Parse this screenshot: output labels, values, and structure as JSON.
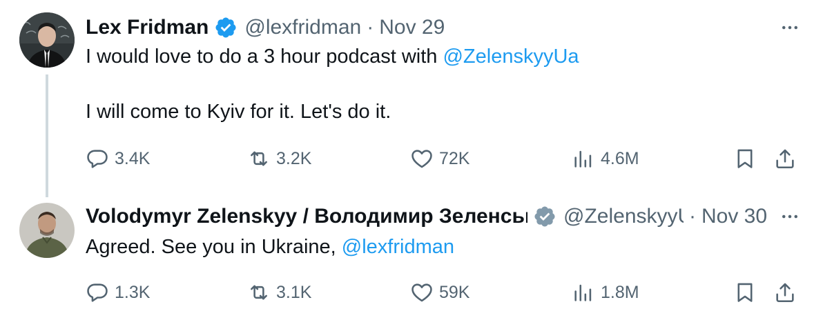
{
  "tweets": [
    {
      "author_name": "Lex Fridman",
      "handle": "@lexfridman",
      "separator": "·",
      "date": "Nov 29",
      "text_line1": "I would love to do a 3 hour podcast with ",
      "mention1": "@ZelenskyyUa",
      "text_line2": "I will come to Kyiv for it. Let's do it.",
      "replies": "3.4K",
      "retweets": "3.2K",
      "likes": "72K",
      "views": "4.6M",
      "verified_color": "#1d9bf0"
    },
    {
      "author_name": "Volodymyr Zelenskyy / Володимир Зеленський",
      "handle": "@ZelenskyyUa",
      "separator": "·",
      "date": "Nov 30",
      "text_line1": "Agreed. See you in Ukraine, ",
      "mention1": "@lexfridman",
      "replies": "1.3K",
      "retweets": "3.1K",
      "likes": "59K",
      "views": "1.8M",
      "verified_color": "#829aab"
    }
  ],
  "colors": {
    "text": "#0f1419",
    "secondary": "#536471",
    "link": "#1d9bf0",
    "thread_line": "#cfd9de"
  },
  "icons": [
    "verified-badge-icon",
    "more-icon",
    "reply-icon",
    "retweet-icon",
    "like-icon",
    "views-icon",
    "bookmark-icon",
    "share-icon"
  ]
}
